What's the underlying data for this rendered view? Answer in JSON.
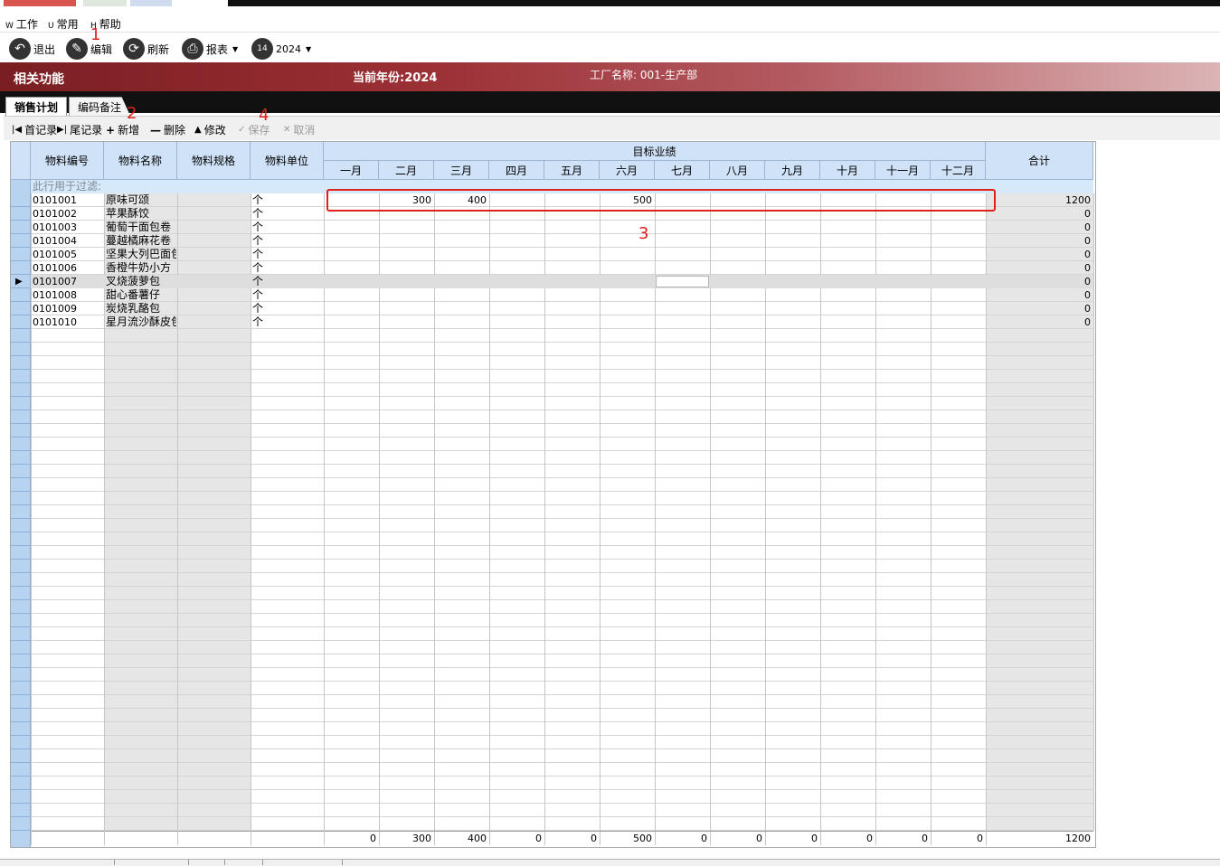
{
  "menu": [
    {
      "hotkey": "W",
      "label": "工作"
    },
    {
      "hotkey": "U",
      "label": "常用"
    },
    {
      "hotkey": "H",
      "label": "帮助"
    }
  ],
  "toolbar": {
    "exit": "退出",
    "edit": "编辑",
    "refresh": "刷新",
    "report": "报表",
    "year": "2024"
  },
  "banner": {
    "title": "相关功能",
    "current_year": "当前年份:2024",
    "factory": "工厂名称: 001-生产部"
  },
  "tabs": [
    "销售计划",
    "编码备注"
  ],
  "record_toolbar": {
    "first": "首记录",
    "last": "尾记录",
    "add": "新增",
    "delete": "删除",
    "modify": "修改",
    "save": "保存",
    "cancel": "取消"
  },
  "grid": {
    "fixed_headers": [
      "物料编号",
      "物料名称",
      "物料规格",
      "物料单位"
    ],
    "group_header": "目标业绩",
    "months": [
      "一月",
      "二月",
      "三月",
      "四月",
      "五月",
      "六月",
      "七月",
      "八月",
      "九月",
      "十月",
      "十一月",
      "十二月"
    ],
    "total_header": "合计",
    "filter_text": "此行用于过滤:",
    "rows": [
      {
        "code": "0101001",
        "name": "原味可颂",
        "spec": "",
        "unit": "个",
        "months": [
          "",
          "300",
          "400",
          "",
          "",
          "500",
          "",
          "",
          "",
          "",
          "",
          ""
        ],
        "total": "1200"
      },
      {
        "code": "0101002",
        "name": "苹果酥饺",
        "spec": "",
        "unit": "个",
        "months": [
          "",
          "",
          "",
          "",
          "",
          "",
          "",
          "",
          "",
          "",
          "",
          ""
        ],
        "total": "0"
      },
      {
        "code": "0101003",
        "name": "葡萄干面包卷",
        "spec": "",
        "unit": "个",
        "months": [
          "",
          "",
          "",
          "",
          "",
          "",
          "",
          "",
          "",
          "",
          "",
          ""
        ],
        "total": "0"
      },
      {
        "code": "0101004",
        "name": "蔓越橘麻花卷",
        "spec": "",
        "unit": "个",
        "months": [
          "",
          "",
          "",
          "",
          "",
          "",
          "",
          "",
          "",
          "",
          "",
          ""
        ],
        "total": "0"
      },
      {
        "code": "0101005",
        "name": "坚果大列巴面包",
        "spec": "",
        "unit": "个",
        "months": [
          "",
          "",
          "",
          "",
          "",
          "",
          "",
          "",
          "",
          "",
          "",
          ""
        ],
        "total": "0"
      },
      {
        "code": "0101006",
        "name": "香橙牛奶小方",
        "spec": "",
        "unit": "个",
        "months": [
          "",
          "",
          "",
          "",
          "",
          "",
          "",
          "",
          "",
          "",
          "",
          ""
        ],
        "total": "0"
      },
      {
        "code": "0101007",
        "name": "叉烧菠萝包",
        "spec": "",
        "unit": "个",
        "months": [
          "",
          "",
          "",
          "",
          "",
          "",
          "",
          "",
          "",
          "",
          "",
          ""
        ],
        "total": "0"
      },
      {
        "code": "0101008",
        "name": "甜心番薯仔",
        "spec": "",
        "unit": "个",
        "months": [
          "",
          "",
          "",
          "",
          "",
          "",
          "",
          "",
          "",
          "",
          "",
          ""
        ],
        "total": "0"
      },
      {
        "code": "0101009",
        "name": "炭烧乳酪包",
        "spec": "",
        "unit": "个",
        "months": [
          "",
          "",
          "",
          "",
          "",
          "",
          "",
          "",
          "",
          "",
          "",
          ""
        ],
        "total": "0"
      },
      {
        "code": "0101010",
        "name": "星月流沙酥皮包",
        "spec": "",
        "unit": "个",
        "months": [
          "",
          "",
          "",
          "",
          "",
          "",
          "",
          "",
          "",
          "",
          "",
          ""
        ],
        "total": "0"
      }
    ],
    "selected_row": 6,
    "footer_months": [
      "0",
      "300",
      "400",
      "0",
      "0",
      "500",
      "0",
      "0",
      "0",
      "0",
      "0",
      "0"
    ],
    "footer_total": "1200"
  },
  "annotations": [
    "1",
    "2",
    "3",
    "4"
  ],
  "colors": {
    "banner_start": "#7a1e22",
    "header_bg": "#cfe2f7",
    "annotation": "#e0201a"
  }
}
